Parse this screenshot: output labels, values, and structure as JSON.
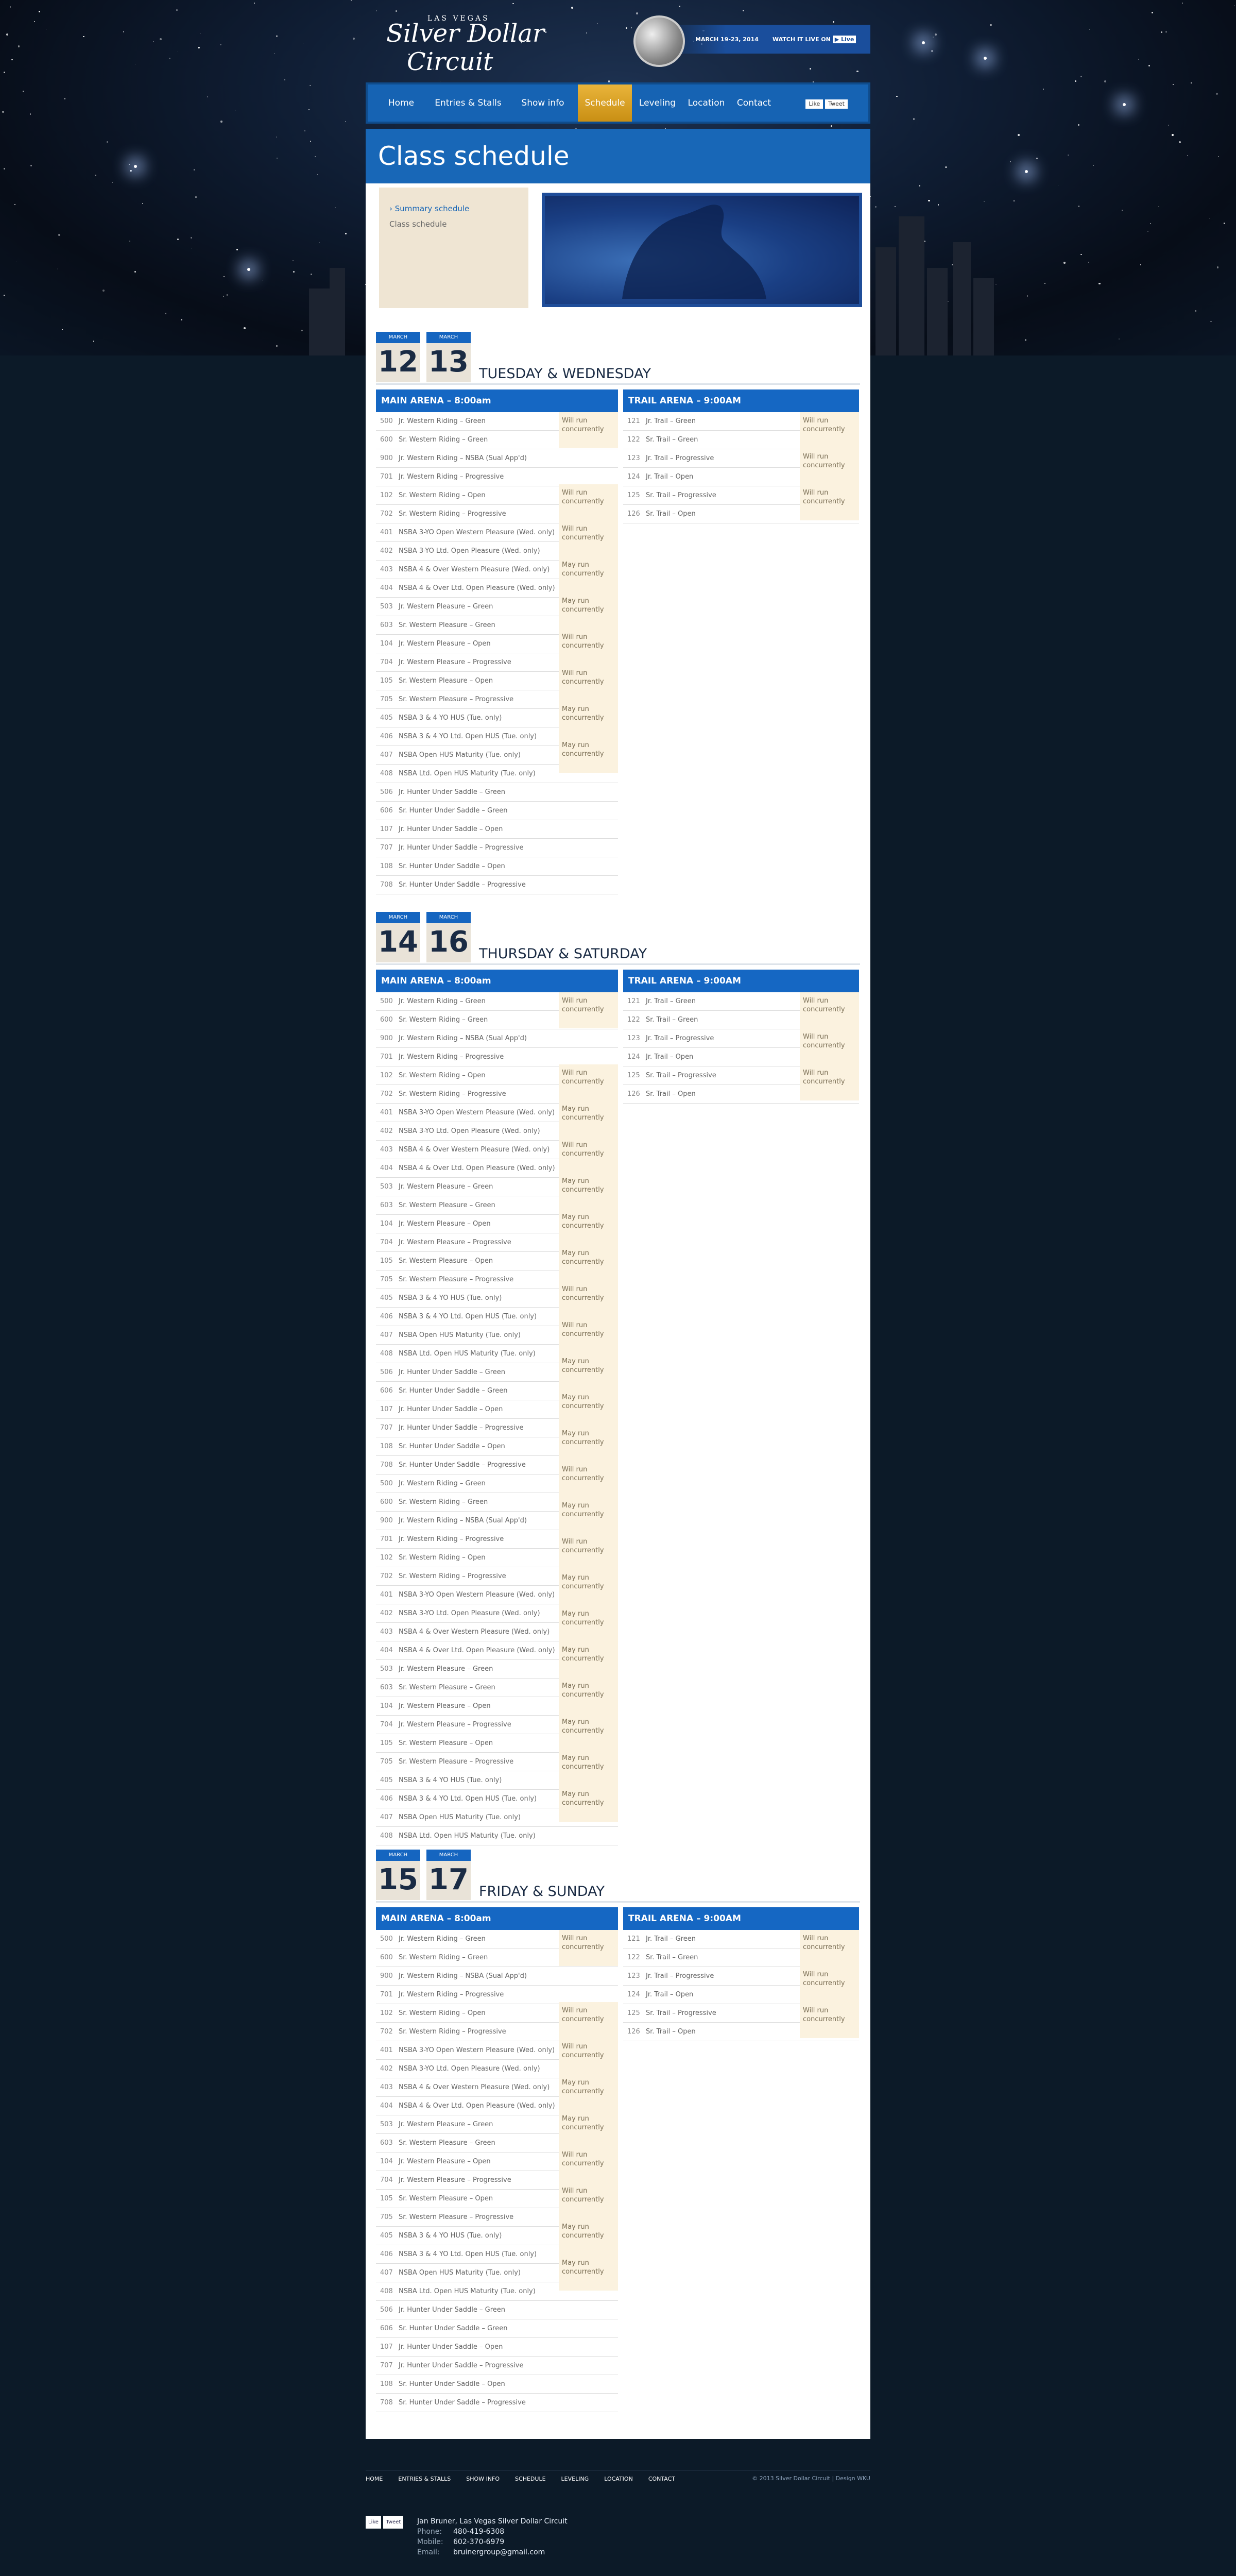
{
  "colors": {
    "accent": "#1567c3",
    "nav_active": "#d9a02c",
    "note_bg": "#fbf2df",
    "page_bg": "#0c1a28"
  },
  "header": {
    "logo": {
      "top": "LAS VEGAS",
      "line1": "Silver Dollar",
      "line2": "Circuit"
    },
    "dates": "MARCH 19-23, 2014",
    "watch": "WATCH IT LIVE ON"
  },
  "nav": {
    "items": [
      {
        "label": "Home"
      },
      {
        "label": "Entries & Stalls"
      },
      {
        "label": "Show info"
      },
      {
        "label": "Schedule"
      },
      {
        "label": "Leveling"
      },
      {
        "label": "Location"
      },
      {
        "label": "Contact"
      }
    ],
    "social": [
      "Like",
      "Tweet"
    ]
  },
  "page": {
    "title": "Class schedule",
    "subnav": [
      "› Summary schedule",
      "Class schedule"
    ]
  },
  "sections": [
    {
      "month": "MARCH",
      "d1": "12",
      "d2": "13",
      "days": "TUESDAY & WEDNESDAY",
      "main_header": "MAIN ARENA – 8:00am",
      "trail_header": "TRAIL ARENA – 9:00AM",
      "main": [
        [
          "500",
          "Jr. Western Riding – Green"
        ],
        [
          "600",
          "Sr. Western Riding – Green"
        ],
        [
          "900",
          "Jr. Western Riding – NSBA (Sual App'd)"
        ],
        [
          "701",
          "Jr. Western Riding – Progressive"
        ],
        [
          "102",
          "Sr. Western Riding – Open"
        ],
        [
          "702",
          "Sr. Western Riding – Progressive"
        ],
        [
          "401",
          "NSBA 3-YO Open Western Pleasure (Wed. only)"
        ],
        [
          "402",
          "NSBA 3-YO Ltd. Open Pleasure (Wed. only)"
        ],
        [
          "403",
          "NSBA 4 & Over Western Pleasure (Wed. only)"
        ],
        [
          "404",
          "NSBA 4 & Over Ltd. Open Pleasure (Wed. only)"
        ],
        [
          "503",
          "Jr. Western Pleasure – Green"
        ],
        [
          "603",
          "Sr. Western Pleasure – Green"
        ],
        [
          "104",
          "Jr. Western Pleasure – Open"
        ],
        [
          "704",
          "Jr. Western Pleasure – Progressive"
        ],
        [
          "105",
          "Sr. Western Pleasure – Open"
        ],
        [
          "705",
          "Sr. Western Pleasure – Progressive"
        ],
        [
          "405",
          "NSBA 3 & 4 YO HUS (Tue. only)"
        ],
        [
          "406",
          "NSBA 3 & 4 YO Ltd. Open HUS (Tue. only)"
        ],
        [
          "407",
          "NSBA Open HUS Maturity (Tue. only)"
        ],
        [
          "408",
          "NSBA Ltd. Open HUS Maturity (Tue. only)"
        ],
        [
          "506",
          "Jr. Hunter Under Saddle – Green"
        ],
        [
          "606",
          "Sr. Hunter Under Saddle – Green"
        ],
        [
          "107",
          "Jr. Hunter Under Saddle – Open"
        ],
        [
          "707",
          "Jr. Hunter Under Saddle – Progressive"
        ],
        [
          "108",
          "Sr. Hunter Under Saddle – Open"
        ],
        [
          "708",
          "Sr. Hunter Under Saddle – Progressive"
        ]
      ],
      "main_notes": [
        "Will run concurrently",
        "",
        "Will run concurrently",
        "Will run concurrently",
        "May run concurrently",
        "May run concurrently",
        "Will run concurrently",
        "Will run concurrently",
        "May run concurrently",
        "May run concurrently"
      ],
      "trail": [
        [
          "121",
          "Jr. Trail – Green"
        ],
        [
          "122",
          "Sr. Trail – Green"
        ],
        [
          "123",
          "Jr. Trail – Progressive"
        ],
        [
          "124",
          "Jr. Trail – Open"
        ],
        [
          "125",
          "Sr. Trail – Progressive"
        ],
        [
          "126",
          "Sr. Trail – Open"
        ]
      ],
      "trail_notes": [
        "Will run concurrently",
        "Will run concurrently",
        "Will run concurrently"
      ]
    },
    {
      "month": "MARCH",
      "d1": "14",
      "d2": "16",
      "days": "THURSDAY & SATURDAY",
      "main_header": "MAIN ARENA – 8:00am",
      "trail_header": "TRAIL ARENA – 9:00AM",
      "main": [
        [
          "500",
          "Jr. Western Riding – Green"
        ],
        [
          "600",
          "Sr. Western Riding – Green"
        ],
        [
          "900",
          "Jr. Western Riding – NSBA (Sual App'd)"
        ],
        [
          "701",
          "Jr. Western Riding – Progressive"
        ],
        [
          "102",
          "Sr. Western Riding – Open"
        ],
        [
          "702",
          "Sr. Western Riding – Progressive"
        ],
        [
          "401",
          "NSBA 3-YO Open Western Pleasure (Wed. only)"
        ],
        [
          "402",
          "NSBA 3-YO Ltd. Open Pleasure (Wed. only)"
        ],
        [
          "403",
          "NSBA 4 & Over Western Pleasure (Wed. only)"
        ],
        [
          "404",
          "NSBA 4 & Over Ltd. Open Pleasure (Wed. only)"
        ],
        [
          "503",
          "Jr. Western Pleasure – Green"
        ],
        [
          "603",
          "Sr. Western Pleasure – Green"
        ],
        [
          "104",
          "Jr. Western Pleasure – Open"
        ],
        [
          "704",
          "Jr. Western Pleasure – Progressive"
        ],
        [
          "105",
          "Sr. Western Pleasure – Open"
        ],
        [
          "705",
          "Sr. Western Pleasure – Progressive"
        ],
        [
          "405",
          "NSBA 3 & 4 YO HUS (Tue. only)"
        ],
        [
          "406",
          "NSBA 3 & 4 YO Ltd. Open HUS (Tue. only)"
        ],
        [
          "407",
          "NSBA Open HUS Maturity (Tue. only)"
        ],
        [
          "408",
          "NSBA Ltd. Open HUS Maturity (Tue. only)"
        ],
        [
          "506",
          "Jr. Hunter Under Saddle – Green"
        ],
        [
          "606",
          "Sr. Hunter Under Saddle – Green"
        ],
        [
          "107",
          "Jr. Hunter Under Saddle – Open"
        ],
        [
          "707",
          "Jr. Hunter Under Saddle – Progressive"
        ],
        [
          "108",
          "Sr. Hunter Under Saddle – Open"
        ],
        [
          "708",
          "Sr. Hunter Under Saddle – Progressive"
        ],
        [
          "500",
          "Jr. Western Riding – Green"
        ],
        [
          "600",
          "Sr. Western Riding – Green"
        ],
        [
          "900",
          "Jr. Western Riding – NSBA (Sual App'd)"
        ],
        [
          "701",
          "Jr. Western Riding – Progressive"
        ],
        [
          "102",
          "Sr. Western Riding – Open"
        ],
        [
          "702",
          "Sr. Western Riding – Progressive"
        ],
        [
          "401",
          "NSBA 3-YO Open Western Pleasure (Wed. only)"
        ],
        [
          "402",
          "NSBA 3-YO Ltd. Open Pleasure (Wed. only)"
        ],
        [
          "403",
          "NSBA 4 & Over Western Pleasure (Wed. only)"
        ],
        [
          "404",
          "NSBA 4 & Over Ltd. Open Pleasure (Wed. only)"
        ],
        [
          "503",
          "Jr. Western Pleasure – Green"
        ],
        [
          "603",
          "Sr. Western Pleasure – Green"
        ],
        [
          "104",
          "Jr. Western Pleasure – Open"
        ],
        [
          "704",
          "Jr. Western Pleasure – Progressive"
        ],
        [
          "105",
          "Sr. Western Pleasure – Open"
        ],
        [
          "705",
          "Sr. Western Pleasure – Progressive"
        ],
        [
          "405",
          "NSBA 3 & 4 YO HUS (Tue. only)"
        ],
        [
          "406",
          "NSBA 3 & 4 YO Ltd. Open HUS (Tue. only)"
        ],
        [
          "407",
          "NSBA Open HUS Maturity (Tue. only)"
        ],
        [
          "408",
          "NSBA Ltd. Open HUS Maturity (Tue. only)"
        ]
      ],
      "main_notes": [
        "Will run concurrently",
        "",
        "Will run concurrently",
        "May run concurrently",
        "Will run concurrently",
        "May run concurrently",
        "May run concurrently",
        "May run concurrently",
        "Will run concurrently",
        "Will run concurrently",
        "May run concurrently",
        "May run concurrently",
        "May run concurrently",
        "Will run concurrently",
        "May run concurrently",
        "Will run concurrently",
        "May run concurrently",
        "May run concurrently",
        "May run concurrently",
        "May run concurrently",
        "May run concurrently",
        "May run concurrently",
        "May run concurrently"
      ],
      "trail": [
        [
          "121",
          "Jr. Trail – Green"
        ],
        [
          "122",
          "Sr. Trail – Green"
        ],
        [
          "123",
          "Jr. Trail – Progressive"
        ],
        [
          "124",
          "Jr. Trail – Open"
        ],
        [
          "125",
          "Sr. Trail – Progressive"
        ],
        [
          "126",
          "Sr. Trail – Open"
        ]
      ],
      "trail_notes": [
        "Will run concurrently",
        "Will run concurrently",
        "Will run concurrently"
      ]
    },
    {
      "month": "MARCH",
      "d1": "15",
      "d2": "17",
      "days": "FRIDAY & SUNDAY",
      "main_header": "MAIN ARENA – 8:00am",
      "trail_header": "TRAIL ARENA – 9:00AM",
      "main": [
        [
          "500",
          "Jr. Western Riding – Green"
        ],
        [
          "600",
          "Sr. Western Riding – Green"
        ],
        [
          "900",
          "Jr. Western Riding – NSBA (Sual App'd)"
        ],
        [
          "701",
          "Jr. Western Riding – Progressive"
        ],
        [
          "102",
          "Sr. Western Riding – Open"
        ],
        [
          "702",
          "Sr. Western Riding – Progressive"
        ],
        [
          "401",
          "NSBA 3-YO Open Western Pleasure (Wed. only)"
        ],
        [
          "402",
          "NSBA 3-YO Ltd. Open Pleasure (Wed. only)"
        ],
        [
          "403",
          "NSBA 4 & Over Western Pleasure (Wed. only)"
        ],
        [
          "404",
          "NSBA 4 & Over Ltd. Open Pleasure (Wed. only)"
        ],
        [
          "503",
          "Jr. Western Pleasure – Green"
        ],
        [
          "603",
          "Sr. Western Pleasure – Green"
        ],
        [
          "104",
          "Jr. Western Pleasure – Open"
        ],
        [
          "704",
          "Jr. Western Pleasure – Progressive"
        ],
        [
          "105",
          "Sr. Western Pleasure – Open"
        ],
        [
          "705",
          "Sr. Western Pleasure – Progressive"
        ],
        [
          "405",
          "NSBA 3 & 4 YO HUS (Tue. only)"
        ],
        [
          "406",
          "NSBA 3 & 4 YO Ltd. Open HUS (Tue. only)"
        ],
        [
          "407",
          "NSBA Open HUS Maturity (Tue. only)"
        ],
        [
          "408",
          "NSBA Ltd. Open HUS Maturity (Tue. only)"
        ],
        [
          "506",
          "Jr. Hunter Under Saddle – Green"
        ],
        [
          "606",
          "Sr. Hunter Under Saddle – Green"
        ],
        [
          "107",
          "Jr. Hunter Under Saddle – Open"
        ],
        [
          "707",
          "Jr. Hunter Under Saddle – Progressive"
        ],
        [
          "108",
          "Sr. Hunter Under Saddle – Open"
        ],
        [
          "708",
          "Sr. Hunter Under Saddle – Progressive"
        ]
      ],
      "main_notes": [
        "Will run concurrently",
        "",
        "Will run concurrently",
        "Will run concurrently",
        "May run concurrently",
        "May run concurrently",
        "Will run concurrently",
        "Will run concurrently",
        "May run concurrently",
        "May run concurrently"
      ],
      "trail": [
        [
          "121",
          "Jr. Trail – Green"
        ],
        [
          "122",
          "Sr. Trail – Green"
        ],
        [
          "123",
          "Jr. Trail – Progressive"
        ],
        [
          "124",
          "Jr. Trail – Open"
        ],
        [
          "125",
          "Sr. Trail – Progressive"
        ],
        [
          "126",
          "Sr. Trail – Open"
        ]
      ],
      "trail_notes": [
        "Will run concurrently",
        "Will run concurrently",
        "Will run concurrently"
      ]
    }
  ],
  "footer": {
    "nav": [
      "HOME",
      "ENTRIES & STALLS",
      "SHOW INFO",
      "SCHEDULE",
      "LEVELING",
      "LOCATION",
      "CONTACT"
    ],
    "copyright": "© 2013 Silver Dollar Circuit  |  Design WKU",
    "contact_name": "Jan Bruner, Las Vegas Silver Dollar Circuit",
    "phone_label": "Phone:",
    "phone": "480-419-6308",
    "mobile_label": "Mobile:",
    "mobile": "602-370-6979",
    "email_label": "Email:",
    "email": "bruinergroup@gmail.com",
    "social": [
      "Like",
      "Tweet"
    ]
  }
}
